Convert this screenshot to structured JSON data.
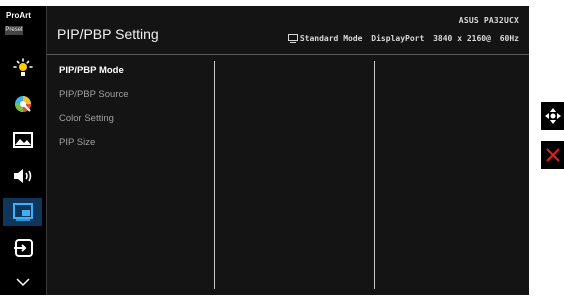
{
  "brand": {
    "line1": "ProArt",
    "line2": "Preset"
  },
  "header": {
    "title": "PIP/PBP Setting",
    "model": "ASUS PA32UCX",
    "status_mode": "Standard Mode",
    "status_input": "DisplayPort",
    "status_resolution": "3840 x 2160@",
    "status_refresh": "60Hz"
  },
  "menu": [
    {
      "label": "PIP/PBP Mode"
    },
    {
      "label": "PIP/PBP Source"
    },
    {
      "label": "Color Setting"
    },
    {
      "label": "PIP Size"
    }
  ],
  "sidebar_icons": [
    "proart-preset-icon",
    "brightness-icon",
    "color-wheel-icon",
    "image-icon",
    "sound-icon",
    "pip-pbp-icon",
    "input-select-icon",
    "chevron-down-icon"
  ],
  "colors": {
    "active_bg": "#10355a",
    "close_red": "#e02020",
    "text_white": "#ffffff",
    "text_gray": "#a0a0a0"
  }
}
